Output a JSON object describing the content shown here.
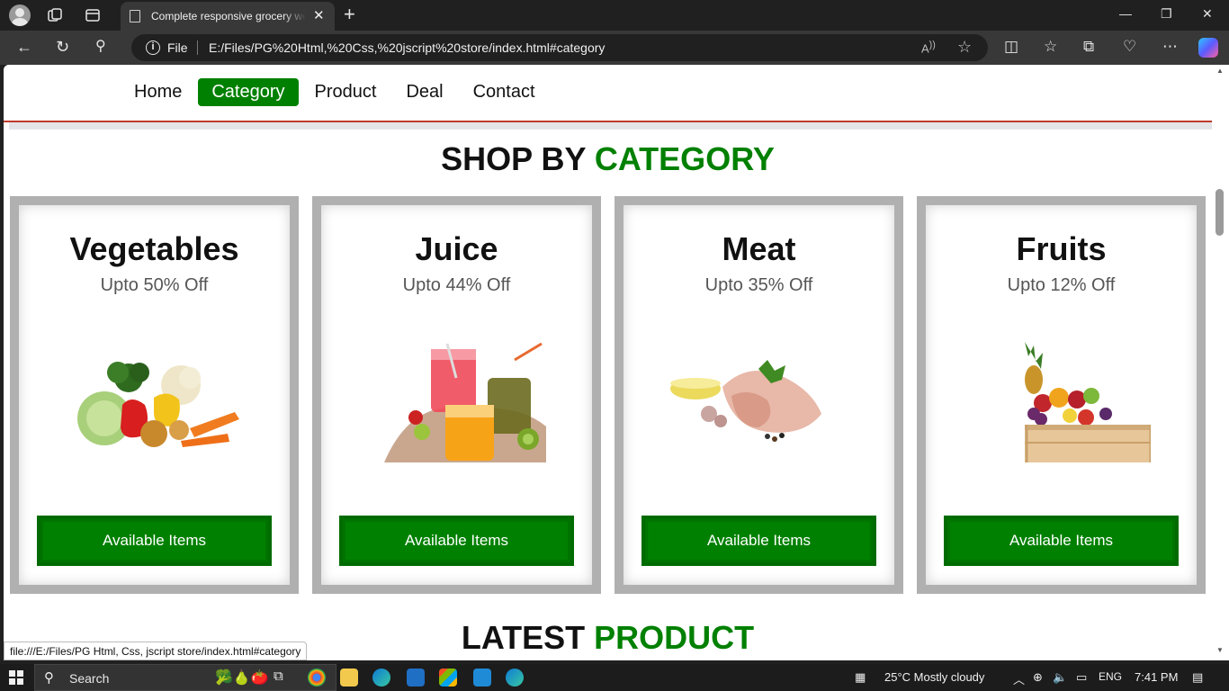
{
  "browser": {
    "tab_title": "Complete responsive grocery website",
    "file_label": "File",
    "url": "E:/Files/PG%20Html,%20Css,%20jscript%20store/index.html#category"
  },
  "nav": {
    "items": [
      {
        "label": "Home",
        "active": false
      },
      {
        "label": "Category",
        "active": true
      },
      {
        "label": "Product",
        "active": false
      },
      {
        "label": "Deal",
        "active": false
      },
      {
        "label": "Contact",
        "active": false
      }
    ]
  },
  "category_section": {
    "heading_main": "SHOP BY",
    "heading_accent": "CATEGORY",
    "cards": [
      {
        "title": "Vegetables",
        "offer": "Upto 50% Off",
        "button": "Available Items",
        "image": "vegetables-image"
      },
      {
        "title": "Juice",
        "offer": "Upto 44% Off",
        "button": "Available Items",
        "image": "juice-image"
      },
      {
        "title": "Meat",
        "offer": "Upto 35% Off",
        "button": "Available Items",
        "image": "meat-image"
      },
      {
        "title": "Fruits",
        "offer": "Upto 12% Off",
        "button": "Available Items",
        "image": "fruits-image"
      }
    ]
  },
  "product_section": {
    "heading_main": "LATEST",
    "heading_accent": "PRODUCT"
  },
  "status_bar": {
    "link": "file:///E:/Files/PG Html, Css, jscript store/index.html#category"
  },
  "taskbar": {
    "search_label": "Search",
    "weather": "25°C  Mostly cloudy",
    "language": "ENG",
    "time": "7:41 PM"
  },
  "colors": {
    "accent": "#008000",
    "header_border": "#c0392b",
    "card_border": "#b0b0b0"
  }
}
